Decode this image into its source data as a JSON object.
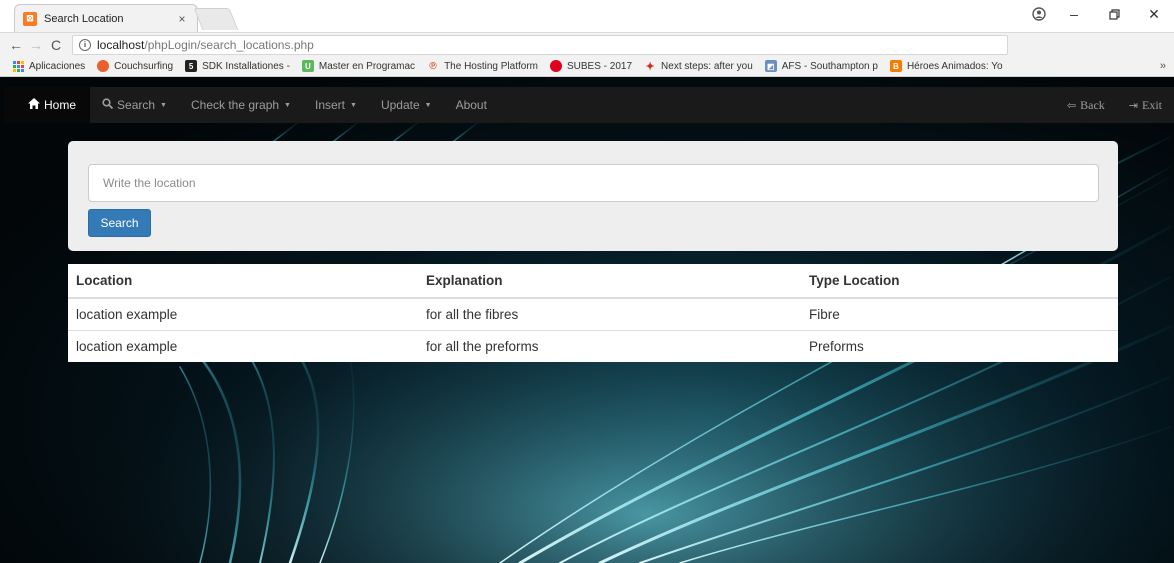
{
  "browser": {
    "tab_title": "Search Location",
    "tab_close": "×",
    "url_host": "localhost",
    "url_path": "/phpLogin/search_locations.php",
    "bookmarks": [
      {
        "label": "Aplicaciones",
        "color": "#4285f4"
      },
      {
        "label": "Couchsurfing",
        "color": "#e8612c"
      },
      {
        "label": "SDK Installationes -",
        "color": "#222222"
      },
      {
        "label": "Master en Programac",
        "color": "#5cb85c"
      },
      {
        "label": "The Hosting Platform",
        "color": "#e2522b"
      },
      {
        "label": "SUBES - 2017",
        "color": "#e0001b"
      },
      {
        "label": "Next steps: after you",
        "color": "#d52b1e"
      },
      {
        "label": "AFS - Southampton p",
        "color": "#6a8fbf"
      },
      {
        "label": "Héroes Animados: Yo",
        "color": "#f57c00"
      }
    ],
    "bookmarks_more": "»"
  },
  "navbar": {
    "home": "Home",
    "search": "Search",
    "check_graph": "Check the graph",
    "insert": "Insert",
    "update": "Update",
    "about": "About",
    "back": "Back",
    "exit": "Exit"
  },
  "search": {
    "placeholder": "Write the location",
    "button": "Search"
  },
  "table": {
    "headers": [
      "Location",
      "Explanation",
      "Type Location"
    ],
    "rows": [
      [
        "location example",
        "for all the fibres",
        "Fibre"
      ],
      [
        "location example",
        "for all the preforms",
        "Preforms"
      ]
    ]
  },
  "colors": {
    "navbar_bg": "#1a1a1a",
    "primary_button": "#337ab7",
    "panel_bg": "#eeeeee"
  }
}
